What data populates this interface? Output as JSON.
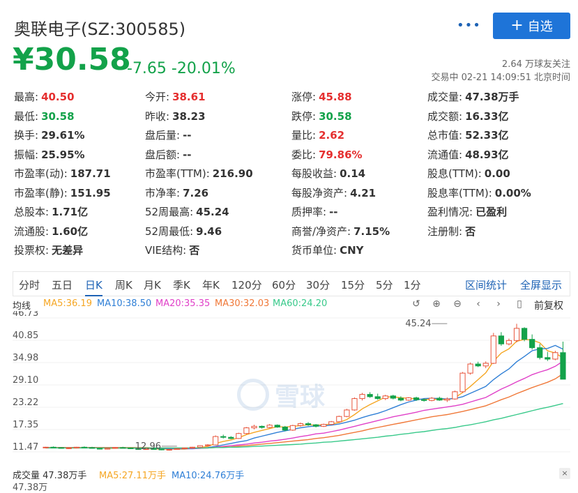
{
  "header": {
    "title": "奥联电子(SZ:300585)",
    "more": "•••",
    "follow_label": "自选",
    "price": "¥30.58",
    "change": "-7.65 -20.01%",
    "followers": "2.64 万球友关注",
    "status": "交易中 02-21 14:09:51 北京时间"
  },
  "quote": [
    [
      {
        "label": "最高:",
        "value": "40.50",
        "tone": "up"
      },
      {
        "label": "今开:",
        "value": "38.61",
        "tone": "up"
      },
      {
        "label": "涨停:",
        "value": "45.88",
        "tone": "up"
      },
      {
        "label": "成交量:",
        "value": "47.38万手",
        "tone": ""
      }
    ],
    [
      {
        "label": "最低:",
        "value": "30.58",
        "tone": "down"
      },
      {
        "label": "昨收:",
        "value": "38.23",
        "tone": ""
      },
      {
        "label": "跌停:",
        "value": "30.58",
        "tone": "down"
      },
      {
        "label": "成交额:",
        "value": "16.33亿",
        "tone": ""
      }
    ],
    [
      {
        "label": "换手:",
        "value": "29.61%",
        "tone": ""
      },
      {
        "label": "盘后量:",
        "value": "--",
        "tone": ""
      },
      {
        "label": "量比:",
        "value": "2.62",
        "tone": "up"
      },
      {
        "label": "总市值:",
        "value": "52.33亿",
        "tone": ""
      }
    ],
    [
      {
        "label": "振幅:",
        "value": "25.95%",
        "tone": ""
      },
      {
        "label": "盘后额:",
        "value": "--",
        "tone": ""
      },
      {
        "label": "委比:",
        "value": "79.86%",
        "tone": "up"
      },
      {
        "label": "流通值:",
        "value": "48.93亿",
        "tone": ""
      }
    ],
    [
      {
        "label": "市盈率(动):",
        "value": "187.71",
        "tone": ""
      },
      {
        "label": "市盈率(TTM):",
        "value": "216.90",
        "tone": ""
      },
      {
        "label": "每股收益:",
        "value": "0.14",
        "tone": ""
      },
      {
        "label": "股息(TTM):",
        "value": "0.00",
        "tone": ""
      }
    ],
    [
      {
        "label": "市盈率(静):",
        "value": "151.95",
        "tone": ""
      },
      {
        "label": "市净率:",
        "value": "7.26",
        "tone": ""
      },
      {
        "label": "每股净资产:",
        "value": "4.21",
        "tone": ""
      },
      {
        "label": "股息率(TTM):",
        "value": "0.00%",
        "tone": ""
      }
    ],
    [
      {
        "label": "总股本:",
        "value": "1.71亿",
        "tone": ""
      },
      {
        "label": "52周最高:",
        "value": "45.24",
        "tone": ""
      },
      {
        "label": "质押率:",
        "value": "--",
        "tone": ""
      },
      {
        "label": "盈利情况:",
        "value": "已盈利",
        "tone": ""
      }
    ],
    [
      {
        "label": "流通股:",
        "value": "1.60亿",
        "tone": ""
      },
      {
        "label": "52周最低:",
        "value": "9.46",
        "tone": ""
      },
      {
        "label": "商誉/净资产:",
        "value": "7.15%",
        "tone": ""
      },
      {
        "label": "注册制:",
        "value": "否",
        "tone": ""
      }
    ],
    [
      {
        "label": "投票权:",
        "value": "无差异",
        "tone": ""
      },
      {
        "label": "VIE结构:",
        "value": "否",
        "tone": ""
      },
      {
        "label": "货币单位:",
        "value": "CNY",
        "tone": ""
      },
      {
        "label": "",
        "value": "",
        "tone": ""
      }
    ]
  ],
  "tabs": [
    "分时",
    "五日",
    "日K",
    "周K",
    "月K",
    "季K",
    "年K",
    "120分",
    "60分",
    "30分",
    "15分",
    "5分",
    "1分"
  ],
  "active_tab": "日K",
  "tab_actions": [
    "区间统计",
    "全屏显示"
  ],
  "ma_bar": {
    "label": "均线",
    "ma5": "MA5:36.19",
    "ma10": "MA10:38.50",
    "ma20": "MA20:35.35",
    "ma30": "MA30:32.03",
    "ma60": "MA60:24.20",
    "adjust": "前复权",
    "colors": {
      "ma5": "#f5a623",
      "ma10": "#2f7fd6",
      "ma20": "#e040c8",
      "ma30": "#f07838",
      "ma60": "#38c98a"
    }
  },
  "volume_bar": {
    "label": "成交量 47.38万手",
    "ma5": "MA5:27.11万手",
    "ma10": "MA10:24.76万手",
    "scale_top": "47.38万",
    "close": "×"
  },
  "watermark": "雪球",
  "chart_data": {
    "type": "candlestick",
    "y_ticks": [
      46.73,
      40.85,
      34.98,
      29.1,
      23.22,
      17.35,
      11.47
    ],
    "ylim": [
      11.47,
      46.73
    ],
    "annotations": [
      {
        "label": "45.24",
        "value": 45.24,
        "index": 52
      },
      {
        "label": "12.96",
        "value": 12.96,
        "index": 17
      }
    ],
    "candles": [
      [
        12.6,
        12.8,
        12.4,
        12.7
      ],
      [
        12.7,
        12.9,
        12.5,
        12.6
      ],
      [
        12.6,
        12.7,
        12.3,
        12.4
      ],
      [
        12.4,
        12.6,
        12.2,
        12.5
      ],
      [
        12.5,
        12.8,
        12.4,
        12.7
      ],
      [
        12.7,
        12.9,
        12.5,
        12.6
      ],
      [
        12.6,
        12.8,
        12.3,
        12.4
      ],
      [
        12.4,
        12.5,
        12.1,
        12.2
      ],
      [
        12.2,
        12.5,
        12.1,
        12.4
      ],
      [
        12.4,
        12.7,
        12.3,
        12.6
      ],
      [
        12.6,
        12.8,
        12.4,
        12.5
      ],
      [
        12.5,
        12.6,
        12.2,
        12.3
      ],
      [
        12.3,
        12.5,
        12.0,
        12.2
      ],
      [
        12.2,
        12.4,
        12.0,
        12.3
      ],
      [
        12.3,
        12.5,
        12.1,
        12.2
      ],
      [
        12.2,
        12.3,
        11.9,
        12.0
      ],
      [
        12.0,
        12.2,
        11.8,
        12.1
      ],
      [
        12.1,
        12.4,
        12.0,
        12.3
      ],
      [
        12.3,
        12.6,
        12.2,
        12.5
      ],
      [
        12.5,
        12.8,
        12.4,
        12.7
      ],
      [
        12.7,
        13.2,
        12.6,
        13.1
      ],
      [
        13.1,
        13.5,
        13.0,
        13.3
      ],
      [
        13.3,
        15.8,
        13.2,
        15.5
      ],
      [
        15.5,
        16.0,
        15.0,
        15.3
      ],
      [
        15.3,
        15.6,
        14.8,
        15.0
      ],
      [
        15.0,
        16.5,
        14.9,
        16.3
      ],
      [
        16.3,
        18.0,
        16.1,
        17.8
      ],
      [
        17.8,
        18.6,
        17.4,
        18.2
      ],
      [
        18.2,
        18.4,
        17.6,
        17.9
      ],
      [
        17.9,
        18.8,
        17.7,
        18.5
      ],
      [
        18.5,
        18.7,
        17.8,
        18.0
      ],
      [
        18.0,
        18.3,
        16.9,
        17.2
      ],
      [
        17.2,
        18.6,
        17.0,
        18.4
      ],
      [
        18.4,
        19.2,
        18.1,
        18.9
      ],
      [
        18.9,
        19.3,
        18.3,
        18.6
      ],
      [
        18.6,
        18.8,
        17.9,
        18.2
      ],
      [
        18.2,
        18.9,
        18.0,
        18.7
      ],
      [
        18.7,
        19.6,
        18.5,
        19.4
      ],
      [
        19.4,
        21.0,
        19.2,
        20.8
      ],
      [
        20.8,
        22.8,
        20.6,
        22.5
      ],
      [
        22.5,
        25.8,
        22.3,
        25.5
      ],
      [
        25.5,
        27.0,
        25.0,
        26.6
      ],
      [
        26.6,
        27.2,
        25.7,
        26.0
      ],
      [
        26.0,
        26.8,
        25.2,
        25.5
      ],
      [
        25.5,
        26.5,
        25.1,
        26.2
      ],
      [
        26.2,
        26.5,
        25.3,
        25.6
      ],
      [
        25.6,
        26.1,
        24.8,
        25.1
      ],
      [
        25.1,
        25.9,
        24.9,
        25.7
      ],
      [
        25.7,
        26.0,
        24.9,
        25.2
      ],
      [
        25.2,
        25.5,
        24.7,
        25.0
      ],
      [
        25.0,
        25.9,
        24.8,
        25.6
      ],
      [
        25.6,
        26.0,
        24.9,
        25.1
      ],
      [
        25.1,
        25.8,
        24.6,
        25.4
      ],
      [
        25.4,
        27.6,
        25.2,
        27.3
      ],
      [
        27.3,
        32.5,
        27.0,
        32.2
      ],
      [
        32.2,
        35.0,
        31.8,
        34.6
      ],
      [
        34.6,
        35.2,
        33.8,
        34.1
      ],
      [
        34.1,
        35.3,
        33.5,
        34.8
      ],
      [
        34.8,
        42.8,
        34.6,
        42.0
      ],
      [
        42.0,
        43.0,
        39.4,
        39.9
      ],
      [
        39.9,
        41.3,
        39.5,
        40.8
      ],
      [
        40.8,
        45.2,
        40.3,
        44.0
      ],
      [
        44.0,
        44.3,
        40.6,
        41.1
      ],
      [
        41.1,
        42.4,
        38.4,
        38.9
      ],
      [
        38.9,
        39.9,
        35.8,
        36.3
      ],
      [
        36.3,
        37.8,
        35.4,
        35.9
      ],
      [
        35.9,
        38.1,
        35.6,
        37.6
      ],
      [
        37.6,
        40.5,
        30.6,
        30.6
      ]
    ],
    "ma_lines": {
      "ma5": [
        12.6,
        12.6,
        12.6,
        12.5,
        12.5,
        12.6,
        12.6,
        12.5,
        12.4,
        12.4,
        12.5,
        12.4,
        12.4,
        12.3,
        12.3,
        12.2,
        12.2,
        12.2,
        12.2,
        12.4,
        12.6,
        12.9,
        13.7,
        14.2,
        14.6,
        15.2,
        16.0,
        16.6,
        17.1,
        17.6,
        18.1,
        18.0,
        18.2,
        18.4,
        18.6,
        18.5,
        18.6,
        18.8,
        19.2,
        20.0,
        21.3,
        22.8,
        23.9,
        24.9,
        25.9,
        26.0,
        25.7,
        25.6,
        25.4,
        25.3,
        25.3,
        25.3,
        25.2,
        25.7,
        27.1,
        28.7,
        30.5,
        32.3,
        35.3,
        37.5,
        38.6,
        40.6,
        41.1,
        40.9,
        40.2,
        38.1,
        37.5,
        36.2
      ],
      "ma10": [
        12.6,
        12.6,
        12.6,
        12.6,
        12.6,
        12.6,
        12.6,
        12.5,
        12.5,
        12.5,
        12.5,
        12.5,
        12.4,
        12.4,
        12.4,
        12.4,
        12.3,
        12.3,
        12.3,
        12.3,
        12.4,
        12.6,
        12.9,
        13.3,
        13.7,
        14.1,
        14.4,
        15.1,
        15.6,
        16.1,
        16.6,
        17.0,
        17.4,
        17.8,
        18.1,
        18.3,
        18.3,
        18.5,
        18.8,
        19.3,
        19.8,
        20.5,
        21.1,
        21.6,
        22.3,
        23.1,
        23.9,
        24.6,
        25.1,
        25.5,
        25.6,
        25.5,
        25.4,
        25.5,
        26.0,
        26.9,
        27.8,
        28.7,
        30.5,
        32.0,
        33.3,
        35.2,
        36.6,
        38.1,
        38.6,
        38.7,
        39.5,
        38.5
      ],
      "ma20": [
        12.6,
        12.6,
        12.6,
        12.6,
        12.6,
        12.6,
        12.6,
        12.6,
        12.6,
        12.6,
        12.5,
        12.5,
        12.5,
        12.5,
        12.5,
        12.5,
        12.5,
        12.4,
        12.4,
        12.4,
        12.4,
        12.5,
        12.7,
        12.9,
        13.1,
        13.3,
        13.5,
        13.8,
        14.0,
        14.3,
        14.5,
        14.8,
        15.1,
        15.5,
        15.8,
        16.2,
        16.4,
        16.8,
        17.2,
        17.7,
        18.2,
        18.7,
        19.2,
        19.7,
        20.2,
        20.7,
        21.1,
        21.5,
        21.9,
        22.4,
        22.7,
        23.0,
        23.3,
        23.6,
        24.0,
        24.6,
        25.2,
        25.8,
        26.9,
        28.0,
        28.9,
        29.9,
        30.8,
        31.8,
        32.5,
        33.1,
        34.0,
        35.35
      ],
      "ma30": [
        12.6,
        12.6,
        12.6,
        12.6,
        12.6,
        12.6,
        12.6,
        12.6,
        12.6,
        12.6,
        12.6,
        12.6,
        12.6,
        12.6,
        12.5,
        12.5,
        12.5,
        12.5,
        12.5,
        12.5,
        12.5,
        12.5,
        12.6,
        12.7,
        12.8,
        13.0,
        13.1,
        13.3,
        13.5,
        13.7,
        13.9,
        14.1,
        14.3,
        14.5,
        14.7,
        15.0,
        15.2,
        15.5,
        15.8,
        16.2,
        16.6,
        17.0,
        17.5,
        17.9,
        18.3,
        18.7,
        19.1,
        19.5,
        19.9,
        20.3,
        20.7,
        21.0,
        21.3,
        21.7,
        22.1,
        22.6,
        23.1,
        23.6,
        24.4,
        25.2,
        25.9,
        26.8,
        27.6,
        28.4,
        29.1,
        29.8,
        30.7,
        32.03
      ],
      "ma60": [
        12.5,
        12.5,
        12.5,
        12.5,
        12.5,
        12.5,
        12.5,
        12.5,
        12.5,
        12.5,
        12.5,
        12.5,
        12.5,
        12.5,
        12.5,
        12.5,
        12.5,
        12.5,
        12.5,
        12.5,
        12.5,
        12.5,
        12.6,
        12.6,
        12.7,
        12.7,
        12.8,
        12.9,
        13.0,
        13.1,
        13.2,
        13.3,
        13.4,
        13.5,
        13.7,
        13.8,
        14.0,
        14.1,
        14.3,
        14.5,
        14.7,
        14.9,
        15.1,
        15.3,
        15.6,
        15.8,
        16.1,
        16.3,
        16.6,
        16.8,
        17.1,
        17.4,
        17.6,
        17.9,
        18.3,
        18.6,
        19.0,
        19.4,
        19.9,
        20.3,
        20.8,
        21.3,
        21.8,
        22.3,
        22.8,
        23.2,
        23.7,
        24.2
      ]
    }
  }
}
